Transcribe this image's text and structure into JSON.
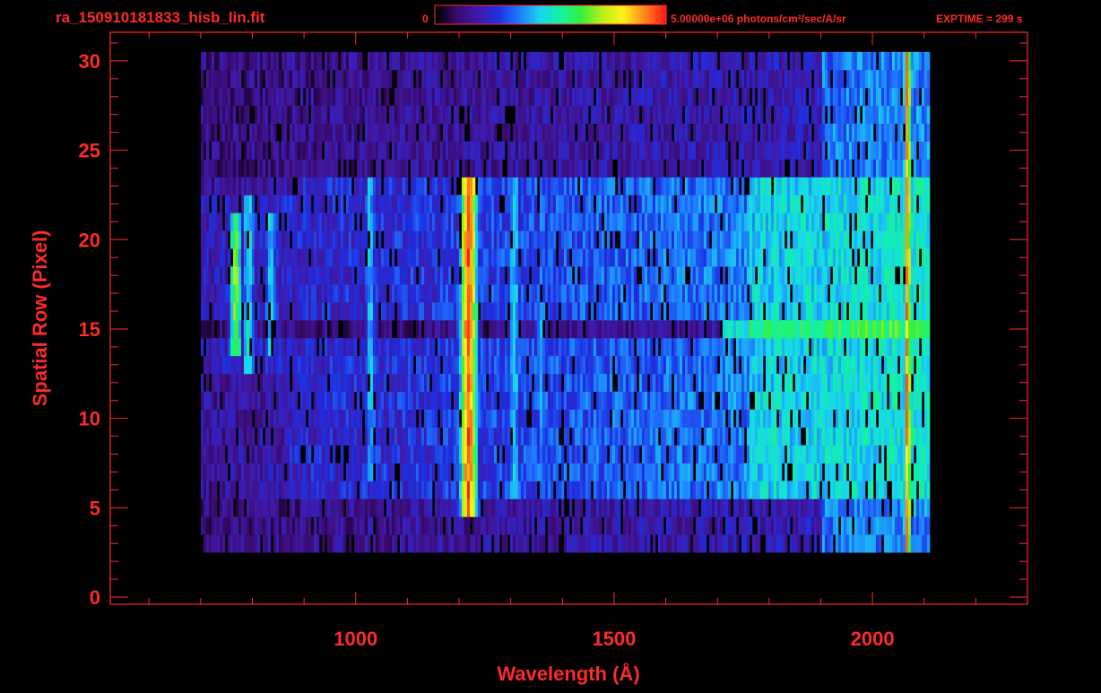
{
  "header": {
    "filename": "ra_150910181833_hisb_lin.fit",
    "colorbar_min_label": "0",
    "colorbar_max_label": "5.00000e+06 photons/cm²/sec/A/sr",
    "exposure": "EXPTIME = 299 s"
  },
  "colors": {
    "text": "#ff2a2a",
    "axis": "#ff2a2a",
    "background": "#000000",
    "colormap": [
      "#000000",
      "#3a0a6e",
      "#3f1aa8",
      "#1f2ee0",
      "#1e7bff",
      "#19d6f0",
      "#12f2a0",
      "#39f03a",
      "#b8f018",
      "#fff21a",
      "#ff8a1a",
      "#ff1a1a"
    ]
  },
  "chart_data": {
    "type": "heatmap",
    "title": "ra_150910181833_hisb_lin.fit",
    "xlabel": "Wavelength (Å)",
    "ylabel": "Spatial Row (Pixel)",
    "xlim": [
      525,
      2300
    ],
    "ylim": [
      -0.4,
      31.6
    ],
    "x_ticks": [
      1000,
      1500,
      2000
    ],
    "y_ticks": [
      0,
      5,
      10,
      15,
      20,
      25,
      30
    ],
    "x_minor_step": 100,
    "y_minor_step": 1,
    "colorbar": {
      "min": 0,
      "max": 5000000,
      "units": "photons/cm²/sec/A/sr"
    },
    "spectrum": {
      "wavelength_range": [
        700,
        2110
      ],
      "strong_rows": [
        6,
        23
      ],
      "weak_rows": [
        3,
        30
      ],
      "central_gap_rows": [
        15,
        16
      ],
      "emission_lines": [
        {
          "wavelength": 765,
          "rows": [
            14,
            21
          ],
          "level": 0.68
        },
        {
          "wavelength": 790,
          "rows": [
            13,
            22
          ],
          "level": 0.5
        },
        {
          "wavelength": 833,
          "rows": [
            14,
            21
          ],
          "level": 0.45
        },
        {
          "wavelength": 1026,
          "rows": [
            7,
            23
          ],
          "level": 0.42
        },
        {
          "wavelength": 1216,
          "rows": [
            5,
            23
          ],
          "level": 0.95
        },
        {
          "wavelength": 1304,
          "rows": [
            6,
            23
          ],
          "level": 0.45
        },
        {
          "wavelength": 1356,
          "rows": [
            7,
            22
          ],
          "level": 0.38
        },
        {
          "wavelength": 1810,
          "rows": [
            6,
            23
          ],
          "level": 0.52
        },
        {
          "wavelength": 2065,
          "rows": [
            3,
            30
          ],
          "level": 0.92
        }
      ]
    }
  }
}
